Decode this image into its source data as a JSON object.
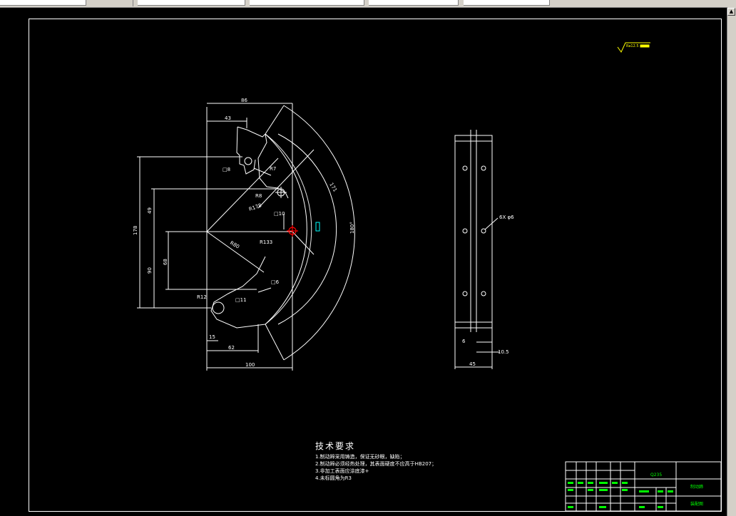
{
  "toolbar": {
    "segments": [
      "",
      "",
      "",
      "",
      ""
    ]
  },
  "drawing": {
    "front_view_dims": {
      "top_86": "86",
      "top_43": "43",
      "height_178": "178",
      "h_49": "49",
      "h_90": "90",
      "h_68": "68",
      "d_15": "15",
      "d_62": "62",
      "d_100": "100",
      "sq_8": "□8",
      "sq_10": "□10",
      "sq_6": "□6",
      "sq_11": "□11",
      "r7": "R7",
      "r8": "R8",
      "r178": "R178",
      "r80": "R80",
      "r133": "R133",
      "r12": "R12",
      "arc_171": "171",
      "angle_180": "180°"
    },
    "side_view_dims": {
      "holes": "6X φ6",
      "d_6": "6",
      "d_10_5": "10.5",
      "width_45": "45"
    },
    "roughness": {
      "label": "Ra12.5"
    }
  },
  "tech_requirements": {
    "title": "技术要求",
    "lines": [
      "1.制动蹄采用铸造，保证无砂眼，缺陷；",
      "2.制动蹄必须经热处理，其表面硬度不应高于HB207；",
      "3.非加工表面应涂底漆+",
      "4.未标圆角为R3"
    ]
  },
  "title_block": {
    "material": "Q235",
    "part_name": "制动蹄",
    "drawing_no": "装配图"
  },
  "colors": {
    "background": "#000000",
    "line": "#ffffff",
    "annotation_green": "#00ff00",
    "roughness_yellow": "#ffff00",
    "center_red": "#ff0000",
    "accent_cyan": "#00ffff"
  }
}
